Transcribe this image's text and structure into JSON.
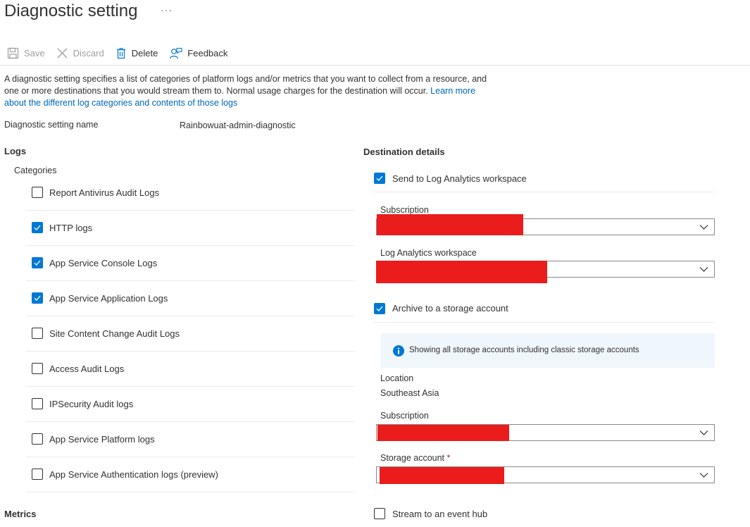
{
  "header": {
    "title": "Diagnostic setting",
    "more": "···"
  },
  "toolbar": {
    "save": "Save",
    "discard": "Discard",
    "delete": "Delete",
    "feedback": "Feedback"
  },
  "description": {
    "text": "A diagnostic setting specifies a list of categories of platform logs and/or metrics that you want to collect from a resource, and one or more destinations that you would stream them to. Normal usage charges for the destination will occur. ",
    "link": "Learn more about the different log categories and contents of those logs"
  },
  "setting_name": {
    "label": "Diagnostic setting name",
    "value": "Rainbowuat-admin-diagnostic"
  },
  "logs": {
    "heading": "Logs",
    "categories_label": "Categories",
    "categories": [
      {
        "label": "Report Antivirus Audit Logs",
        "checked": false
      },
      {
        "label": "HTTP logs",
        "checked": true
      },
      {
        "label": "App Service Console Logs",
        "checked": true
      },
      {
        "label": "App Service Application Logs",
        "checked": true
      },
      {
        "label": "Site Content Change Audit Logs",
        "checked": false
      },
      {
        "label": "Access Audit Logs",
        "checked": false
      },
      {
        "label": "IPSecurity Audit logs",
        "checked": false
      },
      {
        "label": "App Service Platform logs",
        "checked": false
      },
      {
        "label": "App Service Authentication logs (preview)",
        "checked": false
      }
    ]
  },
  "metrics": {
    "heading": "Metrics"
  },
  "destination": {
    "heading": "Destination details",
    "log_analytics": {
      "label": "Send to Log Analytics workspace",
      "checked": true,
      "subscription_label": "Subscription",
      "workspace_label": "Log Analytics workspace"
    },
    "storage": {
      "label": "Archive to a storage account",
      "checked": true,
      "info": "Showing all storage accounts including classic storage accounts",
      "location_label": "Location",
      "location_value": "Southeast Asia",
      "subscription_label": "Subscription",
      "account_label": "Storage account",
      "required_mark": "*"
    },
    "event_hub": {
      "label": "Stream to an event hub",
      "checked": false
    }
  },
  "colors": {
    "accent": "#0078d4",
    "link": "#0067b8",
    "redaction": "#ea1c1c",
    "info_bg": "#eff6fc"
  }
}
